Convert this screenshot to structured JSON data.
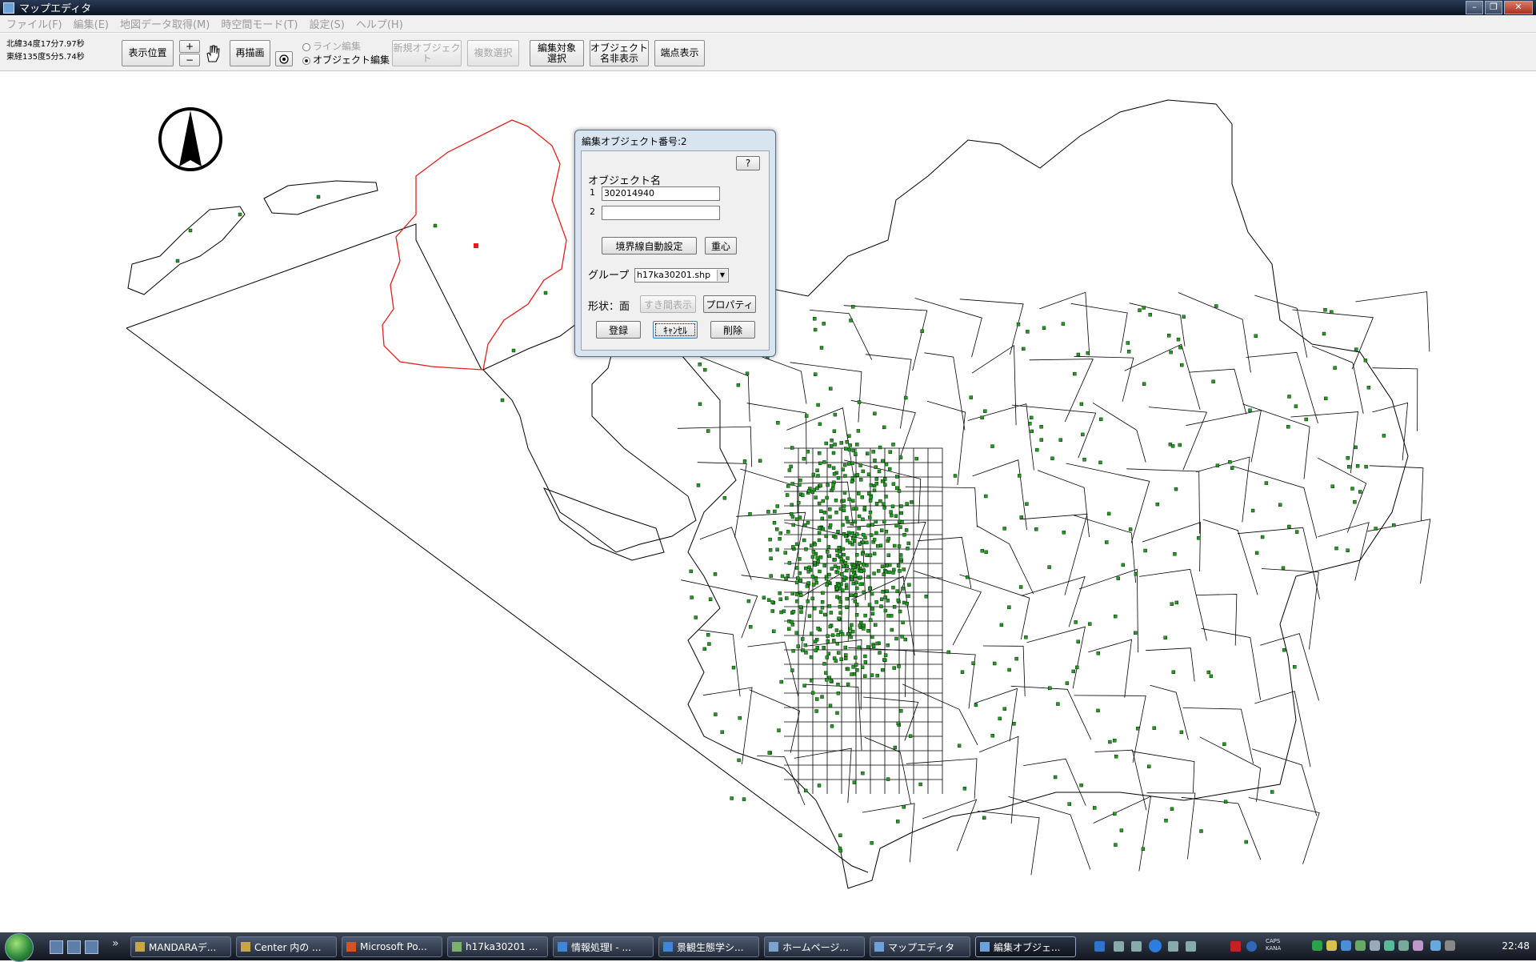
{
  "window": {
    "title": "マップエディタ"
  },
  "menu": [
    "ファイル(F)",
    "編集(E)",
    "地図データ取得(M)",
    "時空間モード(T)",
    "設定(S)",
    "ヘルプ(H)"
  ],
  "toolbar": {
    "coord_lat": "北緯34度17分7.97秒",
    "coord_lon": "東経135度5分5.74秒",
    "display_position": "表示位置",
    "zoom_in": "+",
    "zoom_out": "−",
    "redraw": "再描画",
    "line_edit": "ライン編集",
    "object_edit": "オブジェクト編集",
    "new_object": "新規オブジェクト",
    "multi_select": "複数選択",
    "edit_target_select": "編集対象\n選択",
    "object_name_toggle": "オブジェクト\n名非表示",
    "endpoint_display": "端点表示"
  },
  "dialog": {
    "title": "編集オブジェクト番号:2",
    "help": "?",
    "object_name_label": "オブジェクト名",
    "row1_label": "1",
    "row1_value": "302014940",
    "row2_label": "2",
    "row2_value": "",
    "auto_boundary": "境界線自動設定",
    "centroid": "重心",
    "group_label": "グループ",
    "group_value": "h17ka30201.shp",
    "shape_label": "形状：面",
    "gap_display": "すき間表示",
    "property": "プロパティ",
    "register": "登録",
    "cancel": "ｷｬﾝｾﾙ",
    "delete": "削除"
  },
  "taskbar": {
    "tasks": [
      "MANDARAデ...",
      "Center 内の ...",
      "Microsoft Po...",
      "h17ka30201 ...",
      "情報処理Ⅰ - ...",
      "景観生態学シ...",
      "ホームページ...",
      "マップエディタ",
      "編集オブジェ..."
    ],
    "tray_caps": "CAPS",
    "tray_kana": "KANA",
    "clock": "22:48"
  },
  "colors": {
    "selected_boundary": "#e02020",
    "centroid_point": "#1f9d1f",
    "boundary": "#000000"
  }
}
